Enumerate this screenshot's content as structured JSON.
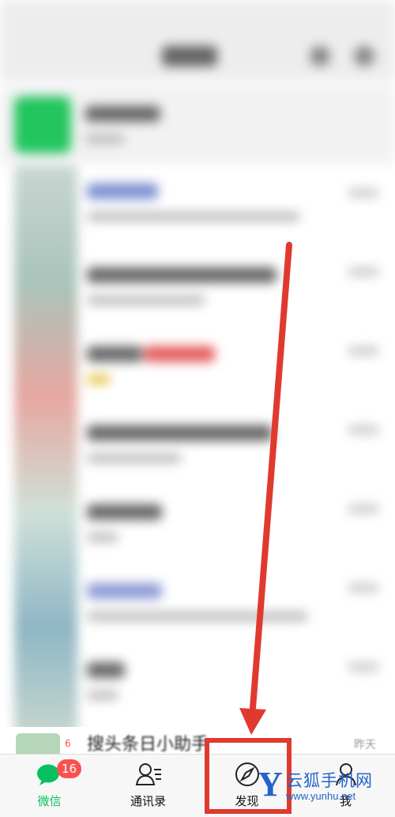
{
  "app": {
    "name": "WeChat"
  },
  "tabbar": {
    "tabs": [
      {
        "label": "微信",
        "icon": "chat-bubbles-icon",
        "active": true,
        "badge": "16"
      },
      {
        "label": "通讯录",
        "icon": "contacts-icon",
        "active": false
      },
      {
        "label": "发现",
        "icon": "compass-icon",
        "active": false
      },
      {
        "label": "我",
        "icon": "person-icon",
        "active": false
      }
    ]
  },
  "chat_list": {
    "last_visible": {
      "title": "搜头条日小助手",
      "time": "昨天",
      "badge": "6"
    }
  },
  "annotation": {
    "highlight_color": "#e03a2f",
    "highlighted_tab": "发现"
  },
  "watermark": {
    "letter": "Y",
    "text": "云狐手机网",
    "url": "www.yunhu.net"
  },
  "colors": {
    "accent_green": "#07c160",
    "badge_red": "#fa5151",
    "watermark_blue": "#2563c9"
  }
}
